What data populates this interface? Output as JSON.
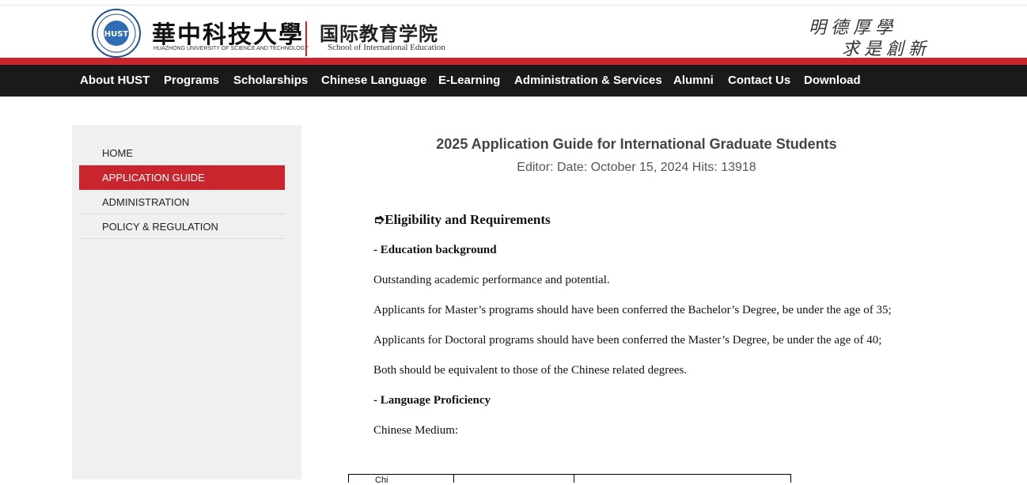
{
  "header": {
    "university_cn": "華中科技大學",
    "university_en": "HUAZHONG UNIVERSITY OF SCIENCE AND TECHNOLOGY",
    "school_cn": "国际教育学院",
    "school_en": "School of International Education",
    "motto_line1": "明德厚學",
    "motto_line2": "求是創新",
    "seal_text": "HUST",
    "brand_color": "#c9252c"
  },
  "nav": {
    "items": [
      {
        "label": "About HUST"
      },
      {
        "label": "Programs"
      },
      {
        "label": "Scholarships"
      },
      {
        "label": "Chinese Language"
      },
      {
        "label": "E-Learning"
      },
      {
        "label": "Administration & Services"
      },
      {
        "label": "Alumni"
      },
      {
        "label": "Contact Us"
      },
      {
        "label": "Download"
      }
    ]
  },
  "sidebar": {
    "items": [
      {
        "label": "HOME",
        "active": false
      },
      {
        "label": "APPLICATION GUIDE",
        "active": true
      },
      {
        "label": "ADMINISTRATION",
        "active": false
      },
      {
        "label": "POLICY & REGULATION",
        "active": false
      }
    ]
  },
  "article": {
    "title": "2025 Application Guide for International Graduate Students",
    "meta": "Editor:  Date: October 15, 2024 Hits: 13918",
    "section_heading": "➮Eligibility and Requirements",
    "edu_heading": "- Education background",
    "para1": "Outstanding academic performance and potential.",
    "para2": "Applicants for Master’s programs should have been conferred the Bachelor’s Degree, be under the age of 35;",
    "para3": "Applicants for Doctoral programs should have been conferred the Master’s Degree, be under the age of 40;",
    "para4": "Both should be equivalent to those of the Chinese related degrees.",
    "lang_heading": "- Language Proficiency",
    "para5": "Chinese Medium:",
    "table_first_cell": "Chi"
  }
}
